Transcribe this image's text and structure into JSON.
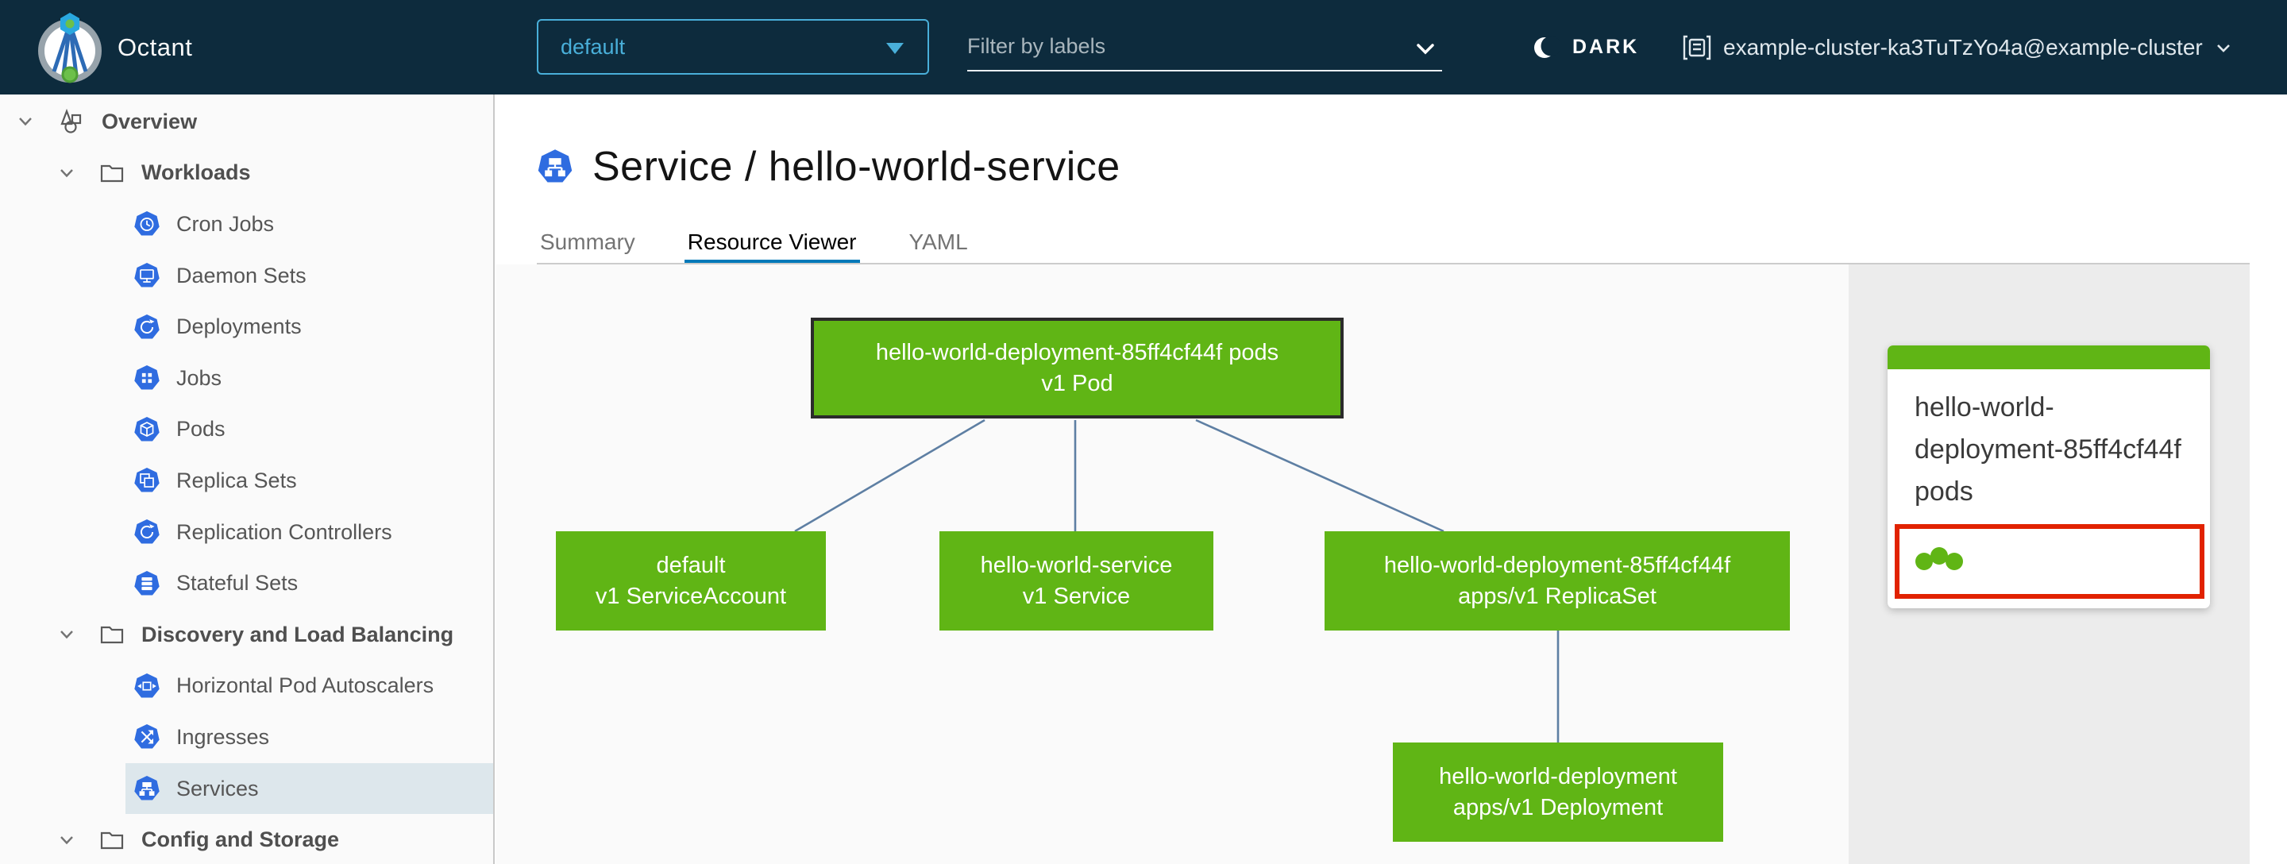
{
  "header": {
    "app_name": "Octant",
    "namespace_selected": "default",
    "filter_placeholder": "Filter by labels",
    "theme_toggle_label": "DARK",
    "cluster_label": "example-cluster-ka3TuTzYo4a@example-cluster"
  },
  "sidebar": {
    "items": [
      {
        "label": "Overview",
        "level": 0,
        "icon": "applications-icon",
        "bold": true,
        "chevron": true,
        "selected": false
      },
      {
        "label": "Workloads",
        "level": 1,
        "icon": "folder-icon",
        "bold": true,
        "chevron": true,
        "selected": false
      },
      {
        "label": "Cron Jobs",
        "level": 2,
        "icon": "cronjob-icon",
        "bold": false,
        "chevron": false,
        "selected": false
      },
      {
        "label": "Daemon Sets",
        "level": 2,
        "icon": "daemonset-icon",
        "bold": false,
        "chevron": false,
        "selected": false
      },
      {
        "label": "Deployments",
        "level": 2,
        "icon": "deployment-icon",
        "bold": false,
        "chevron": false,
        "selected": false
      },
      {
        "label": "Jobs",
        "level": 2,
        "icon": "job-icon",
        "bold": false,
        "chevron": false,
        "selected": false
      },
      {
        "label": "Pods",
        "level": 2,
        "icon": "pod-icon",
        "bold": false,
        "chevron": false,
        "selected": false
      },
      {
        "label": "Replica Sets",
        "level": 2,
        "icon": "replicaset-icon",
        "bold": false,
        "chevron": false,
        "selected": false
      },
      {
        "label": "Replication Controllers",
        "level": 2,
        "icon": "replicationcontroller-icon",
        "bold": false,
        "chevron": false,
        "selected": false
      },
      {
        "label": "Stateful Sets",
        "level": 2,
        "icon": "statefulset-icon",
        "bold": false,
        "chevron": false,
        "selected": false
      },
      {
        "label": "Discovery and Load Balancing",
        "level": 1,
        "icon": "folder-icon",
        "bold": true,
        "chevron": true,
        "selected": false
      },
      {
        "label": "Horizontal Pod Autoscalers",
        "level": 2,
        "icon": "hpa-icon",
        "bold": false,
        "chevron": false,
        "selected": false
      },
      {
        "label": "Ingresses",
        "level": 2,
        "icon": "ingress-icon",
        "bold": false,
        "chevron": false,
        "selected": false
      },
      {
        "label": "Services",
        "level": 2,
        "icon": "service-icon",
        "bold": false,
        "chevron": false,
        "selected": true
      },
      {
        "label": "Config and Storage",
        "level": 1,
        "icon": "folder-icon",
        "bold": true,
        "chevron": true,
        "selected": false
      }
    ]
  },
  "main": {
    "title": "Service / hello-world-service",
    "tabs": [
      {
        "label": "Summary",
        "active": false
      },
      {
        "label": "Resource Viewer",
        "active": true
      },
      {
        "label": "YAML",
        "active": false
      }
    ]
  },
  "graph": {
    "nodes": {
      "pod": {
        "line1": "hello-world-deployment-85ff4cf44f pods",
        "line2": "v1 Pod",
        "selected": true
      },
      "serviceaccount": {
        "line1": "default",
        "line2": "v1 ServiceAccount",
        "selected": false
      },
      "service": {
        "line1": "hello-world-service",
        "line2": "v1 Service",
        "selected": false
      },
      "replicaset": {
        "line1": "hello-world-deployment-85ff4cf44f",
        "line2": "apps/v1 ReplicaSet",
        "selected": false
      },
      "deployment": {
        "line1": "hello-world-deployment",
        "line2": "apps/v1 Deployment",
        "selected": false
      }
    }
  },
  "side_panel": {
    "card": {
      "title": "hello-world-deployment-85ff4cf44f pods",
      "pod_dots": 3
    }
  },
  "colors": {
    "header_bg": "#0d2b3d",
    "accent_blue": "#49afd9",
    "tab_active_underline": "#0079b8",
    "node_green": "#60b515",
    "highlight_red": "#e12200",
    "edge_blue": "#5e7fa3",
    "k8s_icon_blue": "#2f6ce0",
    "selected_row_bg": "#dde7ec"
  }
}
